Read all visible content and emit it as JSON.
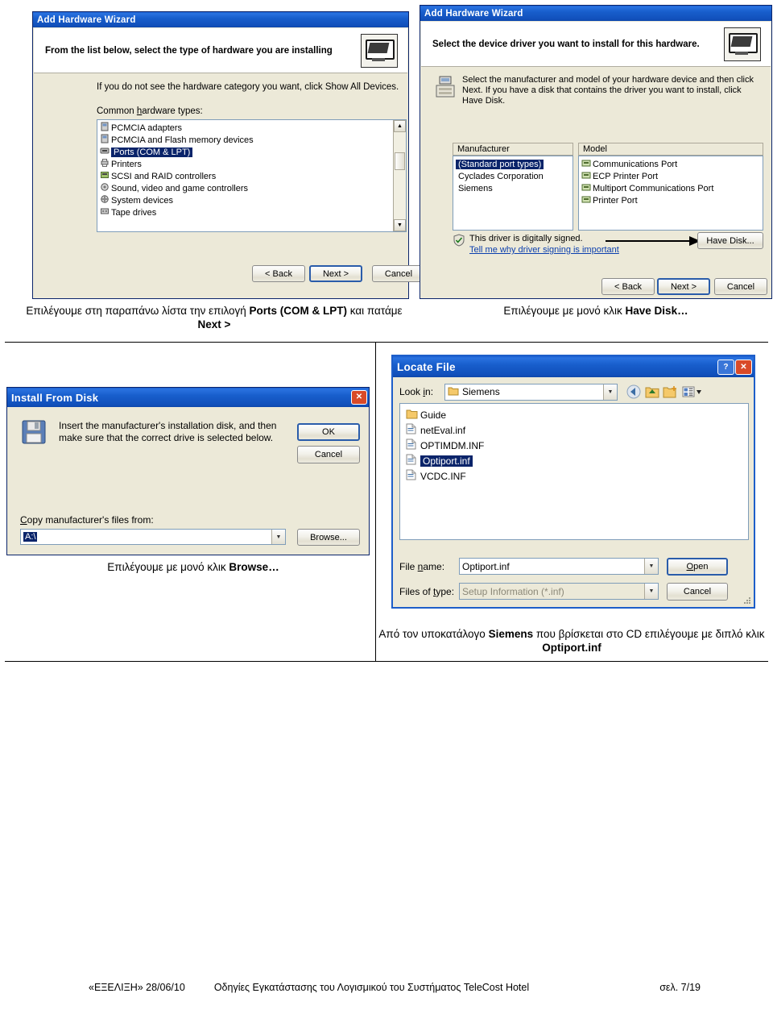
{
  "doc": {
    "footer": {
      "left": "«ΕΞΕΛΙΞΗ» 28/06/10",
      "center": "Οδηγίες Εγκατάστασης του Λογισμικού του Συστήματος TeleCost Hotel",
      "right": "σελ. 7/19"
    }
  },
  "fig1": {
    "title": "Add Hardware Wizard",
    "header": "From the list below, select the type of hardware you are installing",
    "hint": "If you do not see the hardware category you want, click Show All Devices.",
    "list_label": "Common hardware types:",
    "items": [
      {
        "label": "PCMCIA adapters",
        "selected": false
      },
      {
        "label": "PCMCIA and Flash memory devices",
        "selected": false
      },
      {
        "label": "Ports (COM & LPT)",
        "selected": true
      },
      {
        "label": "Printers",
        "selected": false
      },
      {
        "label": "SCSI and RAID controllers",
        "selected": false
      },
      {
        "label": "Sound, video and game controllers",
        "selected": false
      },
      {
        "label": "System devices",
        "selected": false
      },
      {
        "label": "Tape drives",
        "selected": false
      }
    ],
    "buttons": {
      "back": "< Back",
      "next": "Next >",
      "cancel": "Cancel"
    }
  },
  "fig2": {
    "title": "Add Hardware Wizard",
    "header": "Select the device driver you want to install for this hardware.",
    "info": "Select the manufacturer and model of your hardware device and then click Next. If you have a disk that contains the driver you want to install, click Have Disk.",
    "manufacturer_label": "Manufacturer",
    "model_label": "Model",
    "manufacturers": [
      {
        "label": "(Standard port types)",
        "selected": true
      },
      {
        "label": "Cyclades Corporation",
        "selected": false
      },
      {
        "label": "Siemens",
        "selected": false
      }
    ],
    "models": [
      {
        "label": "Communications Port",
        "selected": false
      },
      {
        "label": "ECP Printer Port",
        "selected": false
      },
      {
        "label": "Multiport Communications Port",
        "selected": false
      },
      {
        "label": "Printer Port",
        "selected": false
      }
    ],
    "signed_text": "This driver is digitally signed.",
    "signed_link": "Tell me why driver signing is important",
    "have_disk": "Have Disk...",
    "buttons": {
      "back": "< Back",
      "next": "Next >",
      "cancel": "Cancel"
    }
  },
  "fig3": {
    "title": "Install From Disk",
    "message_line1": "Insert the manufacturer's installation disk, and then",
    "message_line2": "make sure that the correct drive is selected below.",
    "ok": "OK",
    "cancel": "Cancel",
    "copy_label": "Copy manufacturer's files from:",
    "copy_value": "A:\\",
    "browse": "Browse..."
  },
  "fig4": {
    "title": "Locate File",
    "help_btn": "?",
    "close_btn": "✕",
    "lookin_label": "Look in:",
    "lookin_value": "Siemens",
    "files": [
      {
        "label": "Guide",
        "type": "folder",
        "selected": false
      },
      {
        "label": "netEval.inf",
        "type": "inf",
        "selected": false
      },
      {
        "label": "OPTIMDM.INF",
        "type": "inf",
        "selected": false
      },
      {
        "label": "Optiport.inf",
        "type": "inf",
        "selected": true
      },
      {
        "label": "VCDC.INF",
        "type": "inf",
        "selected": false
      }
    ],
    "filename_label": "File name:",
    "filename_value": "Optiport.inf",
    "filetype_label": "Files of type:",
    "filetype_value": "Setup Information (*.inf)",
    "open": "Open",
    "cancel": "Cancel"
  },
  "captions": {
    "c1_part1": "Επιλέγουμε στη παραπάνω λίστα την  επιλογή ",
    "c1_bold1": "Ports (COM & LPT)",
    "c1_part2": " και πατάμε ",
    "c1_bold2": "Next >",
    "c2_part1": "Επιλέγουμε με μονό κλικ  ",
    "c2_bold1": "Have Disk…",
    "c3_part1": "Επιλέγουμε με μονό κλικ  ",
    "c3_bold1": "Browse…",
    "c4_part1": "Από τον υποκατάλογο ",
    "c4_bold1": "Siemens",
    "c4_part2": " που βρίσκεται στο CD επιλέγουμε με διπλό κλικ  ",
    "c4_bold2": "Optiport.inf"
  }
}
